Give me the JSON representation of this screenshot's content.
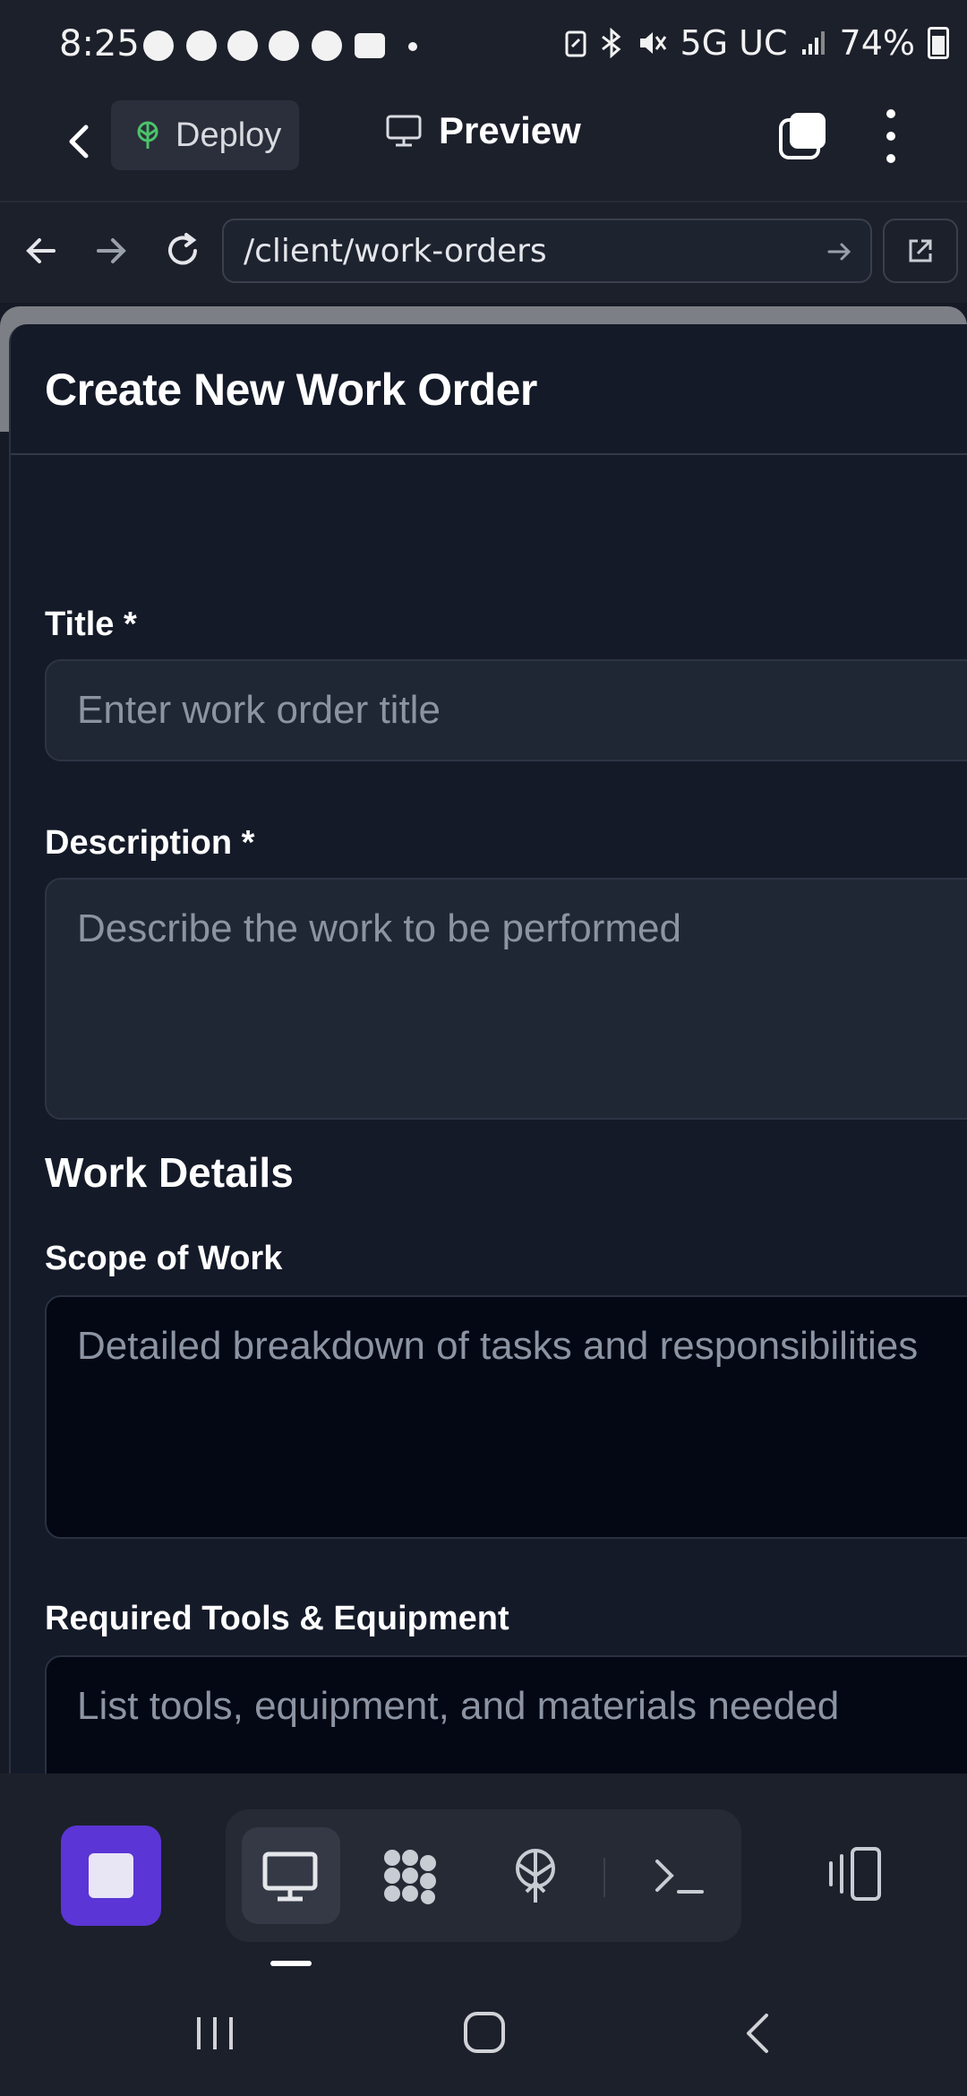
{
  "status_bar": {
    "time": "8:25",
    "network": "5G UC",
    "battery": "74%",
    "icons": [
      "chat-icon",
      "messenger-icon",
      "messenger-icon",
      "messenger-icon",
      "messenger-icon",
      "wallet-icon",
      "battery-saver-icon",
      "bluetooth-icon",
      "mute-icon",
      "signal-icon",
      "battery-icon"
    ]
  },
  "app_bar": {
    "deploy_label": "Deploy",
    "preview_label": "Preview"
  },
  "url_bar": {
    "url": "/client/work-orders"
  },
  "modal": {
    "title": "Create New Work Order",
    "title_label": "Title *",
    "title_placeholder": "Enter work order title",
    "description_label": "Description *",
    "description_placeholder": "Describe the work to be performed",
    "section_work_details": "Work Details",
    "scope_label": "Scope of Work",
    "scope_placeholder": "Detailed breakdown of tasks and responsibilities",
    "tools_label": "Required Tools & Equipment",
    "tools_placeholder": "List tools, equipment, and materials needed"
  },
  "colors": {
    "accent": "#5b35d5",
    "background": "#1c202b",
    "modal_bg": "#141a28",
    "field_bg": "#1f2735",
    "placeholder": "#8c94a3"
  }
}
